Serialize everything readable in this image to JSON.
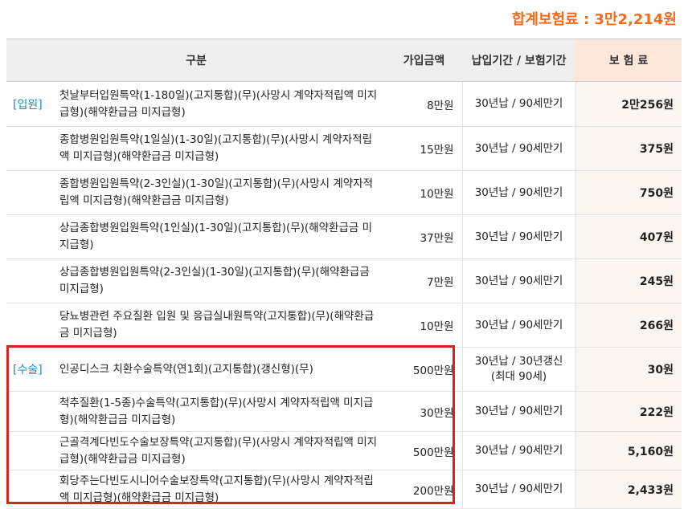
{
  "total": {
    "label": "합계보험료 : 3만2,214원"
  },
  "headers": {
    "category": "구분",
    "amount": "가입금액",
    "period": "납입기간 / 보험기간",
    "premium": "보 험 료"
  },
  "rows": [
    {
      "category": "[입원]",
      "name": "첫날부터입원특약(1-180일)(고지통합)(무)(사망시 계약자적립액 미지급형)(해약환급금 미지급형)",
      "amount": "8만원",
      "period": "30년납 / 90세만기",
      "premium": "2만256원"
    },
    {
      "category": "",
      "name": "종합병원입원특약(1일실)(1-30일)(고지통합)(무)(사망시 계약자적립액 미지급형)(해약환급금 미지급형)",
      "amount": "15만원",
      "period": "30년납 / 90세만기",
      "premium": "375원"
    },
    {
      "category": "",
      "name": "종합병원입원특약(2-3인실)(1-30일)(고지통합)(무)(사망시 계약자적립액 미지급형)(해약환급금 미지급형)",
      "amount": "10만원",
      "period": "30년납 / 90세만기",
      "premium": "750원"
    },
    {
      "category": "",
      "name": "상급종합병원입원특약(1인실)(1-30일)(고지통합)(무)(해약환급금 미지급형)",
      "amount": "37만원",
      "period": "30년납 / 90세만기",
      "premium": "407원"
    },
    {
      "category": "",
      "name": "상급종합병원입원특약(2-3인실)(1-30일)(고지통합)(무)(해약환급금 미지급형)",
      "amount": "7만원",
      "period": "30년납 / 90세만기",
      "premium": "245원"
    },
    {
      "category": "",
      "name": "당뇨병관련 주요질환 입원 및 응급실내원특약(고지통합)(무)(해약환급금 미지급형)",
      "amount": "10만원",
      "period": "30년납 / 90세만기",
      "premium": "266원"
    },
    {
      "category": "[수술]",
      "name": "인공디스크 치환수술특약(연1회)(고지통합)(갱신형)(무)",
      "amount": "500만원",
      "period": "30년납 / 30년갱신",
      "period2": "(최대 90세)",
      "premium": "30원"
    },
    {
      "category": "",
      "name": "척추질환(1-5종)수술특약(고지통합)(무)(사망시 계약자적립액 미지급형)(해약환급금 미지급형)",
      "amount": "30만원",
      "period": "30년납 / 90세만기",
      "premium": "222원"
    },
    {
      "category": "",
      "name": "근골격계다빈도수술보장특약(고지통합)(무)(사망시 계약자적립액 미지급형)(해약환급금 미지급형)",
      "amount": "500만원",
      "period": "30년납 / 90세만기",
      "premium": "5,160원"
    },
    {
      "category": "",
      "name": "회당주는다빈도시니어수술보장특약(고지통합)(무)(사망시 계약자적립액 미지급형)(해약환급금 미지급형)",
      "amount": "200만원",
      "period": "30년납 / 90세만기",
      "premium": "2,433원"
    }
  ],
  "highlight_color": "#d9241c",
  "accent_color": "#f26b1d"
}
